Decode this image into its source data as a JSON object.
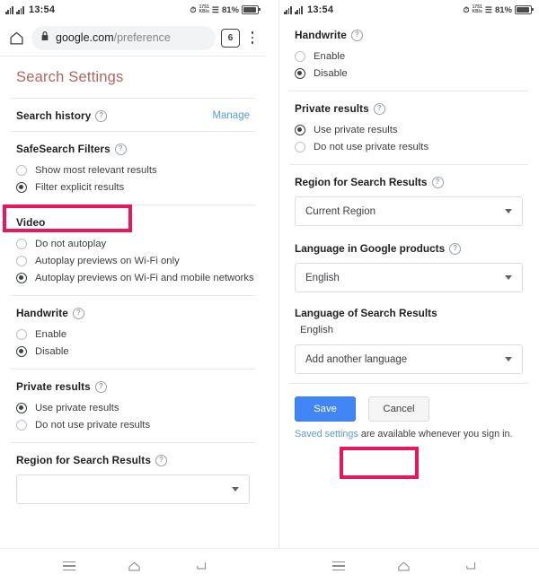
{
  "status_bar": {
    "time": "13:54",
    "signal_icon": "signal-bars-icon",
    "alarm_icon": "alarm-icon",
    "data_speed": "1751 KB/s",
    "wifi_icon": "wifi-icon",
    "battery_percent": "81%",
    "battery_icon": "battery-icon"
  },
  "browser": {
    "home_icon": "home-icon",
    "lock_icon": "lock-icon",
    "url_domain": "google.com",
    "url_path": "/preference",
    "tab_count": "6",
    "menu_icon": "kebab-menu-icon"
  },
  "colors": {
    "accent_highlight": "#e8175d",
    "title": "#b4645c",
    "link": "#5b9bd5",
    "save_button": "#4285f4"
  },
  "left_panel": {
    "page_title": "Search Settings",
    "search_history": {
      "title": "Search history",
      "help_icon": "help-circle-icon",
      "manage_label": "Manage"
    },
    "safesearch": {
      "title": "SafeSearch Filters",
      "help_icon": "help-circle-icon",
      "options": [
        {
          "label": "Show most relevant results",
          "checked": false
        },
        {
          "label": "Filter explicit results",
          "checked": true
        }
      ]
    },
    "video": {
      "title": "Video",
      "options": [
        {
          "label": "Do not autoplay",
          "checked": false
        },
        {
          "label": "Autoplay previews on Wi-Fi only",
          "checked": false
        },
        {
          "label": "Autoplay previews on Wi-Fi and mobile networks",
          "checked": true
        }
      ]
    },
    "handwrite": {
      "title": "Handwrite",
      "help_icon": "help-circle-icon",
      "options": [
        {
          "label": "Enable",
          "checked": false
        },
        {
          "label": "Disable",
          "checked": true
        }
      ]
    },
    "private_results": {
      "title": "Private results",
      "help_icon": "help-circle-icon",
      "options": [
        {
          "label": "Use private results",
          "checked": true
        },
        {
          "label": "Do not use private results",
          "checked": false
        }
      ]
    },
    "region": {
      "title": "Region for Search Results",
      "help_icon": "help-circle-icon"
    }
  },
  "right_panel": {
    "handwrite": {
      "title": "Handwrite",
      "help_icon": "help-circle-icon",
      "options": [
        {
          "label": "Enable",
          "checked": false
        },
        {
          "label": "Disable",
          "checked": true
        }
      ]
    },
    "private_results": {
      "title": "Private results",
      "help_icon": "help-circle-icon",
      "options": [
        {
          "label": "Use private results",
          "checked": true
        },
        {
          "label": "Do not use private results",
          "checked": false
        }
      ]
    },
    "region": {
      "title": "Region for Search Results",
      "help_icon": "help-circle-icon",
      "selected": "Current Region",
      "caret_icon": "chevron-down-icon"
    },
    "language_products": {
      "title": "Language in Google products",
      "help_icon": "help-circle-icon",
      "selected": "English",
      "caret_icon": "chevron-down-icon"
    },
    "language_results": {
      "title": "Language of Search Results",
      "current": "English",
      "add_placeholder": "Add another language",
      "caret_icon": "chevron-down-icon"
    },
    "actions": {
      "save_label": "Save",
      "cancel_label": "Cancel",
      "footnote_link": "Saved settings",
      "footnote_rest": " are available whenever you sign in."
    }
  },
  "nav_bar": {
    "recents_icon": "recents-icon",
    "home_icon": "home-icon",
    "back_icon": "back-icon"
  }
}
